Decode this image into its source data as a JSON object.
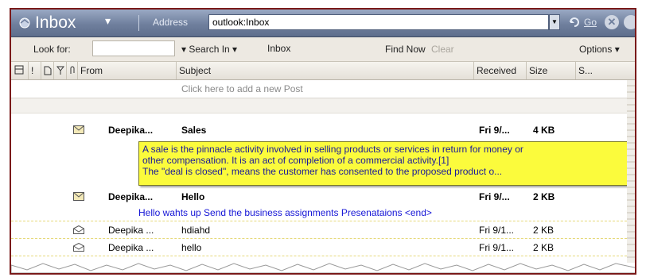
{
  "titlebar": {
    "title": "Inbox",
    "title_dropdown": "▾",
    "address_label": "Address",
    "address_value": "outlook:Inbox",
    "go_label": "Go"
  },
  "findbar": {
    "look_for_label": "Look for:",
    "search_in_label": "▾ Search In ▾",
    "search_in_value": "Inbox",
    "find_now_label": "Find Now",
    "clear_label": "Clear",
    "options_label": "Options ▾"
  },
  "columns": {
    "importance": "!",
    "from": "From",
    "subject": "Subject",
    "received": "Received",
    "size": "Size",
    "sensitivity": "S..."
  },
  "new_post_text": "Click here to add a new Post",
  "messages": [
    {
      "from": "Deepika...",
      "subject": "Sales",
      "received": "Fri 9/...",
      "size": "4 KB",
      "unread": true
    },
    {
      "from": "Deepika...",
      "subject": "Hello",
      "received": "Fri 9/...",
      "size": "2 KB",
      "unread": true,
      "preview": "Hello wahts up Send the business assignments Presenataions <end>"
    },
    {
      "from": "Deepika ...",
      "subject": "hdiahd",
      "received": "Fri 9/1...",
      "size": "2 KB",
      "unread": false
    },
    {
      "from": "Deepika ...",
      "subject": "hello",
      "received": "Fri 9/1...",
      "size": "2 KB",
      "unread": false
    }
  ],
  "tooltip": {
    "line1": "A sale is the pinnacle activity involved in selling products or services in return for money or",
    "line2": "other compensation. It is an act of completion of a commercial activity.[1]",
    "line3": "The \"deal is closed\", means the customer has consented to the proposed product o..."
  },
  "colors": {
    "titlebar": "#6f7f9d",
    "tooltip_bg": "#fbfb3c",
    "preview_text": "#1515d6",
    "window_border": "#7a1a1a"
  }
}
